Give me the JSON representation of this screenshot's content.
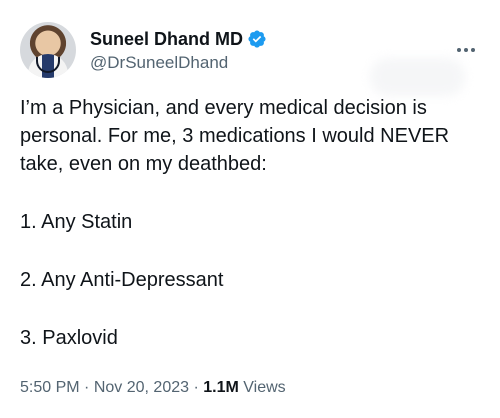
{
  "tweet": {
    "author": {
      "display_name": "Suneel Dhand MD",
      "handle": "@DrSuneelDhand",
      "verified": true
    },
    "text": {
      "paragraph": "I’m a Physician, and every medical decision is personal. For me, 3 medications I would NEVER take, even on my deathbed:",
      "items": [
        "1. Any Statin",
        "2. Any Anti-Depressant",
        "3. Paxlovid"
      ]
    },
    "meta": {
      "time": "5:50 PM",
      "separator_1": "·",
      "date": "Nov 20, 2023",
      "separator_2": "·",
      "views_count": "1.1M",
      "views_label": "Views"
    }
  },
  "colors": {
    "text": "#0f1419",
    "muted": "#536471",
    "verified": "#1d9bf0",
    "background": "#ffffff"
  },
  "icons": {
    "verified": "verified-badge-icon",
    "more": "more-options-icon"
  }
}
